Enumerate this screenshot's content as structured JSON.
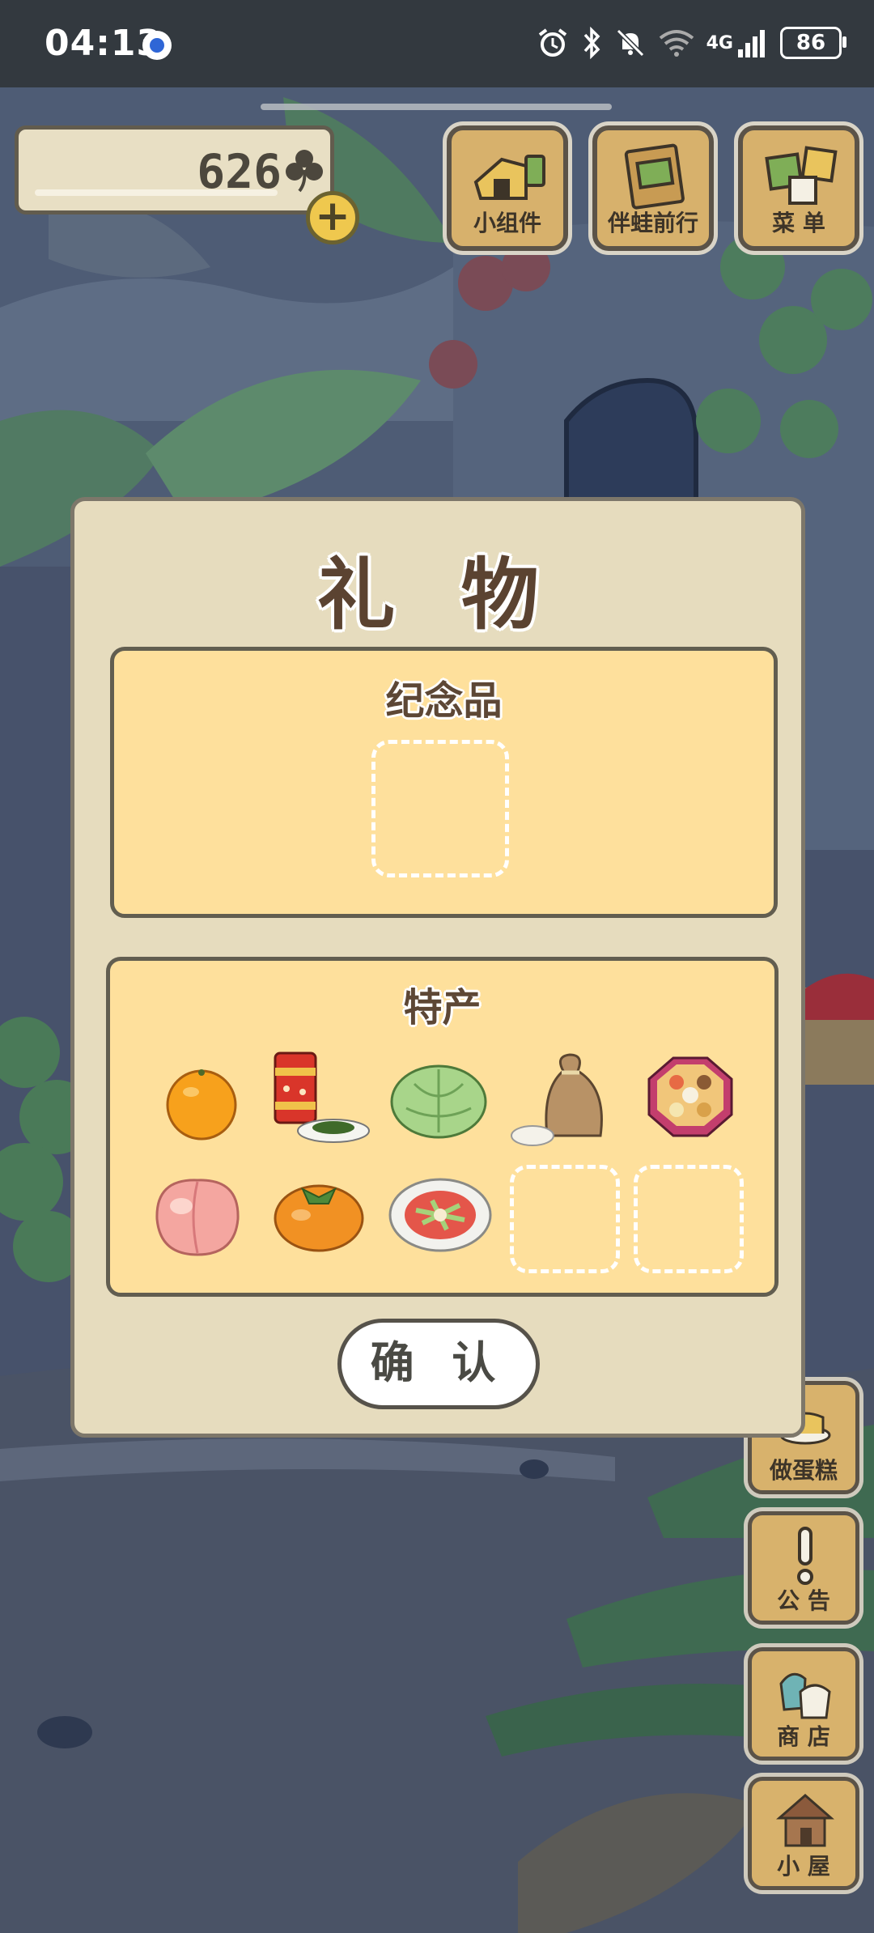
{
  "status_bar": {
    "time": "04:13",
    "network": "4G",
    "battery": "86",
    "icons": [
      "alarm-icon",
      "bluetooth-icon",
      "mute-icon",
      "wifi-icon",
      "signal-icon"
    ]
  },
  "hud": {
    "clover_count": "626",
    "clover_icon": "clover-icon",
    "buttons": [
      {
        "label": "小组件",
        "icon": "widget-icon"
      },
      {
        "label": "伴蛙前行",
        "icon": "album-icon"
      },
      {
        "label": "菜 单",
        "icon": "menu-icon"
      }
    ]
  },
  "side_buttons": [
    {
      "label": "做蛋糕",
      "icon": "cake-icon"
    },
    {
      "label": "公 告",
      "icon": "exclamation-icon"
    },
    {
      "label": "商 店",
      "icon": "shop-bags-icon"
    },
    {
      "label": "小 屋",
      "icon": "house-icon"
    }
  ],
  "dialog": {
    "title": "礼 物",
    "souvenir": {
      "title": "纪念品"
    },
    "specialty": {
      "title": "特产",
      "items": [
        "orange",
        "tea-canister",
        "cabbage",
        "rice-sack",
        "osechi-box",
        "peach",
        "persimmon",
        "salad-plate"
      ]
    },
    "confirm_label": "确 认"
  },
  "colors": {
    "dialog_bg": "#e6dcbe",
    "section_bg": "#fee09c",
    "hud_wood": "#d7b16c",
    "status_bar": "#33393f"
  }
}
